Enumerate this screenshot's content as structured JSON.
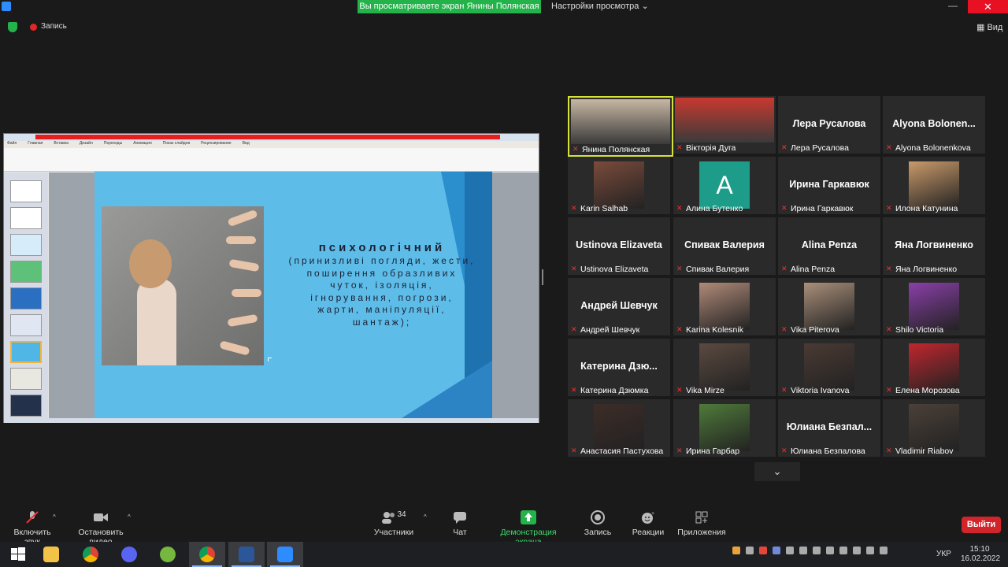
{
  "top_bar": {
    "share_banner": "Вы просматриваете экран Янины Полянская",
    "view_settings": "Настройки просмотра",
    "close_glyph": "✕",
    "minimize_glyph": "—"
  },
  "meeting_status": {
    "record_label": "Запись",
    "view_label": "Вид"
  },
  "shared_screen": {
    "ribbon_tabs": [
      "Файл",
      "Главная",
      "Вставка",
      "Дизайн",
      "Переходы",
      "Анимация",
      "Показ слайдов",
      "Рецензирование",
      "Вид"
    ],
    "slide_heading": "психологічний",
    "slide_body": "(принизливі погляди, жести, поширення образливих чуток, ізоляція, ігнорування, погрози, жарти, маніпуляції, шантаж);"
  },
  "gallery": {
    "tiles": [
      {
        "name": "Янина Полянская",
        "kind": "video",
        "color": "#c7b7a3",
        "active": true
      },
      {
        "name": "Вікторія Дуга",
        "kind": "video",
        "color": "#c8392f"
      },
      {
        "name": "Лера Русалова",
        "kind": "text",
        "big": "Лера Русалова"
      },
      {
        "name": "Alyona Bolonenkova",
        "kind": "text",
        "big": "Alyona  Bolonen..."
      },
      {
        "name": "Karin Salhab",
        "kind": "photo",
        "color": "#7a4b3b"
      },
      {
        "name": "Алина Бутенко",
        "kind": "avatar",
        "color": "#1e9c8a",
        "letter": "A"
      },
      {
        "name": "Ирина Гаркавюк",
        "kind": "text",
        "big": "Ирина Гаркавюк"
      },
      {
        "name": "Илона Катунина",
        "kind": "photo",
        "color": "#c99a6a"
      },
      {
        "name": "Ustinova Elizaveta",
        "kind": "text",
        "big": "Ustinova Elizaveta"
      },
      {
        "name": "Спивак Валерия",
        "kind": "text",
        "big": "Спивак Валерия"
      },
      {
        "name": "Alina Penza",
        "kind": "text",
        "big": "Alina Penza"
      },
      {
        "name": "Яна Логвиненко",
        "kind": "text",
        "big": "Яна Логвиненко"
      },
      {
        "name": "Андрей Шевчук",
        "kind": "text",
        "big": "Андрей Шевчук"
      },
      {
        "name": "Karina Kolesnik",
        "kind": "photo",
        "color": "#b08a78"
      },
      {
        "name": "Vika Piterova",
        "kind": "photo",
        "color": "#a98f7a"
      },
      {
        "name": "Shilo Victoria",
        "kind": "photo",
        "color": "#8a3fa8"
      },
      {
        "name": "Катерина Дзюмка",
        "kind": "text",
        "big": "Катерина  Дзю..."
      },
      {
        "name": "Vika Mirze",
        "kind": "photo",
        "color": "#5b4a40"
      },
      {
        "name": "Viktoria Ivanova",
        "kind": "photo",
        "color": "#4a3a33"
      },
      {
        "name": "Елена Морозова",
        "kind": "photo",
        "color": "#c0262e"
      },
      {
        "name": "Анастасия Пастухова",
        "kind": "photo",
        "color": "#3d2c28"
      },
      {
        "name": "Ирина Гарбар",
        "kind": "photo",
        "color": "#4f7a3a"
      },
      {
        "name": "Юлиана Безпалова",
        "kind": "text",
        "big": "Юлиана  Безпал..."
      },
      {
        "name": "Vladimir Riabov",
        "kind": "photo",
        "color": "#4b4038"
      }
    ],
    "chevron": "⌄"
  },
  "toolbar": {
    "audio": "Включить звук",
    "video": "Остановить видео",
    "participants": "Участники",
    "participants_count": "34",
    "chat": "Чат",
    "share": "Демонстрация экрана",
    "record": "Запись",
    "reactions": "Реакции",
    "apps": "Приложения",
    "end": "Выйти"
  },
  "taskbar": {
    "lang": "УКР",
    "time": "15:10",
    "date": "16.02.2022"
  },
  "colors": {
    "accent_green": "#23b34a",
    "end_red": "#d1252b",
    "active_speaker": "#d8e03a"
  }
}
